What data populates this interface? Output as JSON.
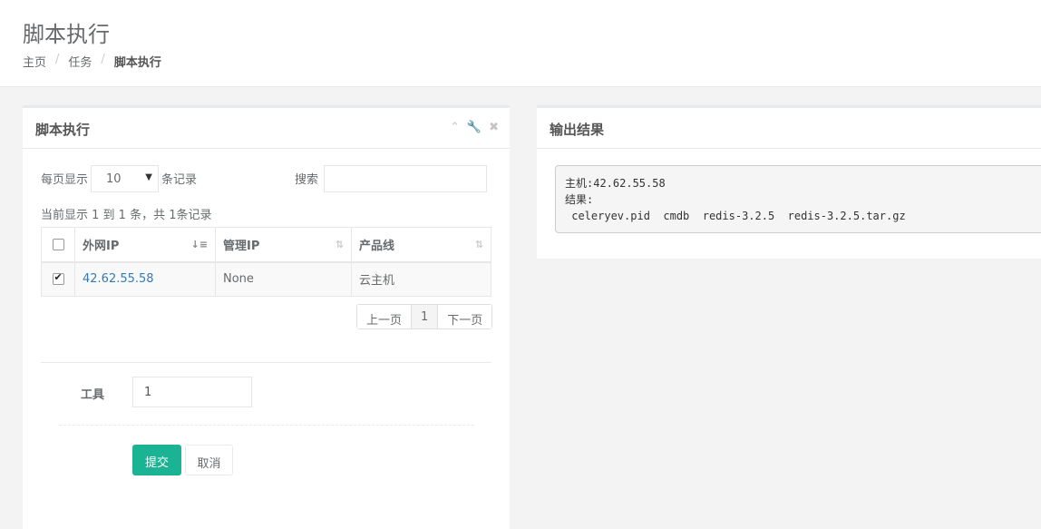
{
  "header": {
    "title": "脚本执行",
    "breadcrumb": [
      "主页",
      "任务",
      "脚本执行"
    ]
  },
  "left_panel": {
    "title": "脚本执行",
    "tools": [
      "chevron-up-icon",
      "wrench-icon",
      "close-icon"
    ],
    "length_label": "每页显示",
    "length_value": "10",
    "length_suffix": "条记录",
    "search_label": "搜索",
    "search_value": "",
    "info": "当前显示 1 到 1 条，共 1条记录",
    "columns": [
      "外网IP",
      "管理IP",
      "产品线"
    ],
    "rows": [
      {
        "checked": true,
        "public_ip": "42.62.55.58",
        "manage_ip": "None",
        "product": "云主机"
      }
    ],
    "pager": {
      "prev": "上一页",
      "current": "1",
      "next": "下一页"
    },
    "tool_label": "工具",
    "tool_value": "1",
    "submit_label": "提交",
    "cancel_label": "取消"
  },
  "right_panel": {
    "title": "输出结果",
    "output": "主机:42.62.55.58\n结果:\n celeryev.pid  cmdb  redis-3.2.5  redis-3.2.5.tar.gz"
  },
  "colors": {
    "accent": "#1ab394",
    "link": "#337ab7"
  }
}
